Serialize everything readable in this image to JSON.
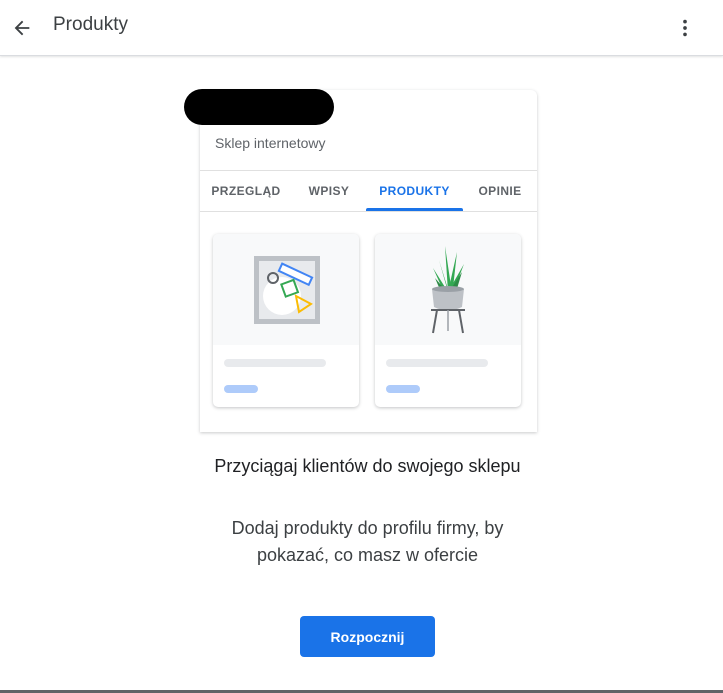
{
  "header": {
    "title": "Produkty",
    "back_icon": "arrow-back-icon",
    "menu_icon": "more-vert-icon"
  },
  "preview": {
    "subtitle": "Sklep internetowy",
    "tabs": [
      {
        "label": "PRZEGLĄD",
        "active": false
      },
      {
        "label": "WPISY",
        "active": false
      },
      {
        "label": "PRODUKTY",
        "active": true
      },
      {
        "label": "OPINIE",
        "active": false
      }
    ],
    "products": [
      {
        "icon": "shapes-frame-icon"
      },
      {
        "icon": "potted-plant-icon"
      }
    ]
  },
  "main": {
    "headline": "Przyciągaj klientów do swojego sklepu",
    "description_lines": [
      "Dodaj produkty do profilu firmy, by",
      "pokazać, co masz w ofercie"
    ],
    "cta_label": "Rozpocznij"
  },
  "colors": {
    "accent": "#1a73e8",
    "text_primary": "#202124",
    "text_secondary": "#5f6368"
  }
}
